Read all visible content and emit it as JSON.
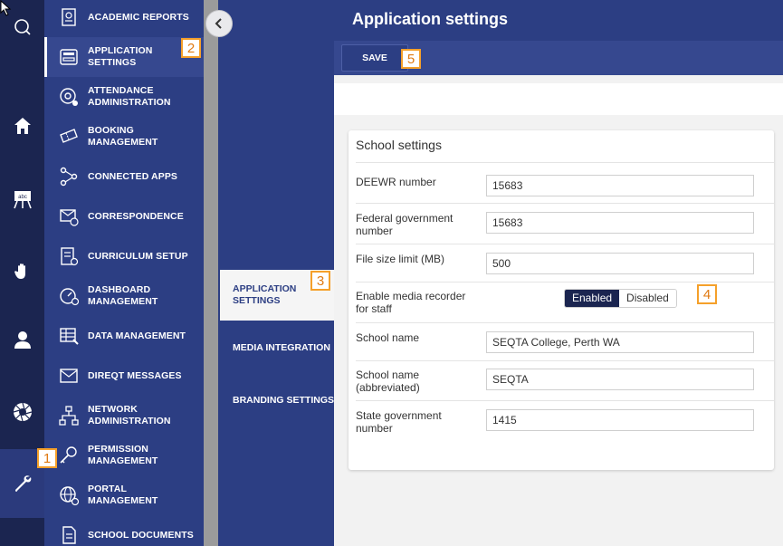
{
  "rail": {
    "items": [
      {
        "icon": "search-icon"
      },
      {
        "icon": "home-icon"
      },
      {
        "icon": "classroom-icon"
      },
      {
        "icon": "hand-icon"
      },
      {
        "icon": "user-icon"
      },
      {
        "icon": "aperture-icon"
      },
      {
        "icon": "wrench-icon",
        "active": true
      }
    ]
  },
  "menu": {
    "items": [
      {
        "label": "ACADEMIC REPORTS",
        "icon": "report-icon"
      },
      {
        "label": "APPLICATION SETTINGS",
        "icon": "settings-panel-icon",
        "active": true
      },
      {
        "label": "ATTENDANCE ADMINISTRATION",
        "icon": "at-gear-icon"
      },
      {
        "label": "BOOKING MANAGEMENT",
        "icon": "ticket-icon"
      },
      {
        "label": "CONNECTED APPS",
        "icon": "network-icon"
      },
      {
        "label": "CORRESPONDENCE",
        "icon": "mail-chat-icon"
      },
      {
        "label": "CURRICULUM SETUP",
        "icon": "list-gear-icon"
      },
      {
        "label": "DASHBOARD MANAGEMENT",
        "icon": "gauge-gear-icon"
      },
      {
        "label": "DATA MANAGEMENT",
        "icon": "table-edit-icon"
      },
      {
        "label": "DIREQT MESSAGES",
        "icon": "inbox-icon"
      },
      {
        "label": "NETWORK ADMINISTRATION",
        "icon": "hierarchy-icon"
      },
      {
        "label": "PERMISSION MANAGEMENT",
        "icon": "key-icon"
      },
      {
        "label": "PORTAL MANAGEMENT",
        "icon": "globe-gear-icon"
      },
      {
        "label": "SCHOOL DOCUMENTS",
        "icon": "document-icon"
      }
    ]
  },
  "subnav": {
    "items": [
      {
        "label": "APPLICATION SETTINGS",
        "active": true
      },
      {
        "label": "MEDIA INTEGRATION"
      },
      {
        "label": "BRANDING SETTINGS"
      }
    ]
  },
  "main": {
    "title": "Application settings",
    "save_label": "SAVE"
  },
  "card": {
    "title": "School settings",
    "rows": [
      {
        "label": "DEEWR number",
        "value": "15683"
      },
      {
        "label": "Federal government number",
        "value": "15683"
      },
      {
        "label": "File size limit (MB)",
        "value": "500"
      },
      {
        "label": "Enable media recorder for staff",
        "toggle": [
          "Enabled",
          "Disabled"
        ],
        "selected": "Enabled"
      },
      {
        "label": "School name",
        "value": "SEQTA College, Perth WA"
      },
      {
        "label": "School name (abbreviated)",
        "value": "SEQTA"
      },
      {
        "label": "State government number",
        "value": "1415"
      }
    ]
  },
  "callouts": [
    "1",
    "2",
    "3",
    "4",
    "5"
  ],
  "colors": {
    "rail": "#1b2550",
    "nav": "#2c3e83",
    "accent_callout": "#f5a02a"
  }
}
